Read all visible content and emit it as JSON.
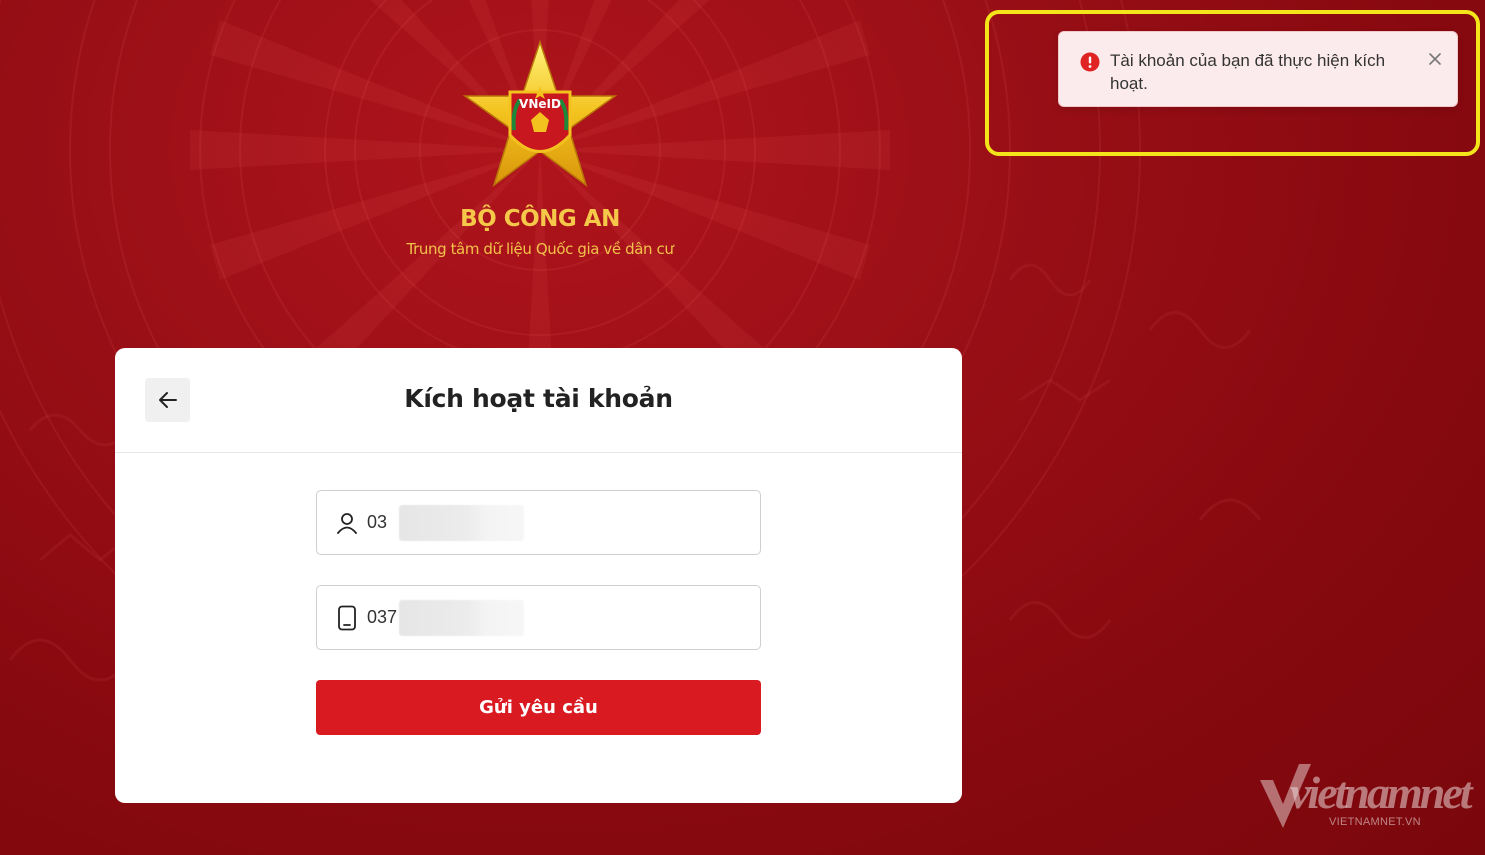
{
  "header": {
    "org_name": "BỘ CÔNG AN",
    "org_subtitle": "Trung tâm dữ liệu Quốc gia về dân cư",
    "emblem_text": "VNeID"
  },
  "card": {
    "title": "Kích hoạt tài khoản",
    "username_field": {
      "value": "03",
      "icon": "user-icon"
    },
    "phone_field": {
      "value": "037",
      "icon": "phone-icon"
    },
    "submit_label": "Gửi yêu cầu"
  },
  "toast": {
    "message": "Tài khoản của bạn đã thực hiện kích hoạt.",
    "icon": "error-icon",
    "close_icon": "close-icon"
  },
  "watermark": {
    "text": "vietnamnet",
    "sub": "VIETNAMNET.VN"
  },
  "colors": {
    "background": "#9a0f16",
    "primary_button": "#d91a21",
    "toast_bg": "#fcebec",
    "highlight": "#f4e51a",
    "gold": "#f6c84a"
  }
}
